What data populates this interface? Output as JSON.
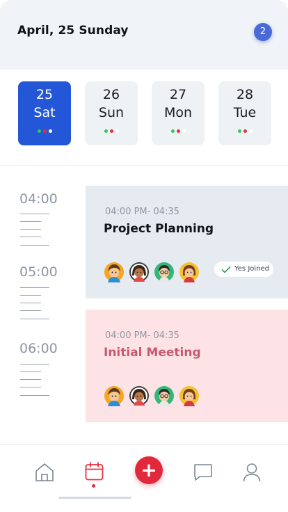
{
  "header": {
    "title": "April, 25 Sunday",
    "notification_count": "2"
  },
  "dates": [
    {
      "num": "25",
      "day": "Sat",
      "active": true
    },
    {
      "num": "26",
      "day": "Sun",
      "active": false
    },
    {
      "num": "27",
      "day": "Mon",
      "active": false
    },
    {
      "num": "28",
      "day": "Tue",
      "active": false
    }
  ],
  "timeline": {
    "times": [
      "04:00",
      "05:00",
      "06:00"
    ]
  },
  "events": [
    {
      "time_range": "04:00 PM- 04:35",
      "title": "Project Planning",
      "status": "Yes Joined"
    },
    {
      "time_range": "04:00 PM- 04:35",
      "title": "Initial Meeting"
    }
  ],
  "colors": {
    "accent_blue": "#2357d8",
    "accent_red": "#e2293c",
    "dot_green": "#34c759",
    "dot_red": "#e2323f"
  },
  "nav": {
    "items": [
      "home-icon",
      "calendar-icon",
      "add-icon",
      "chat-icon",
      "profile-icon"
    ],
    "active": "calendar-icon"
  }
}
